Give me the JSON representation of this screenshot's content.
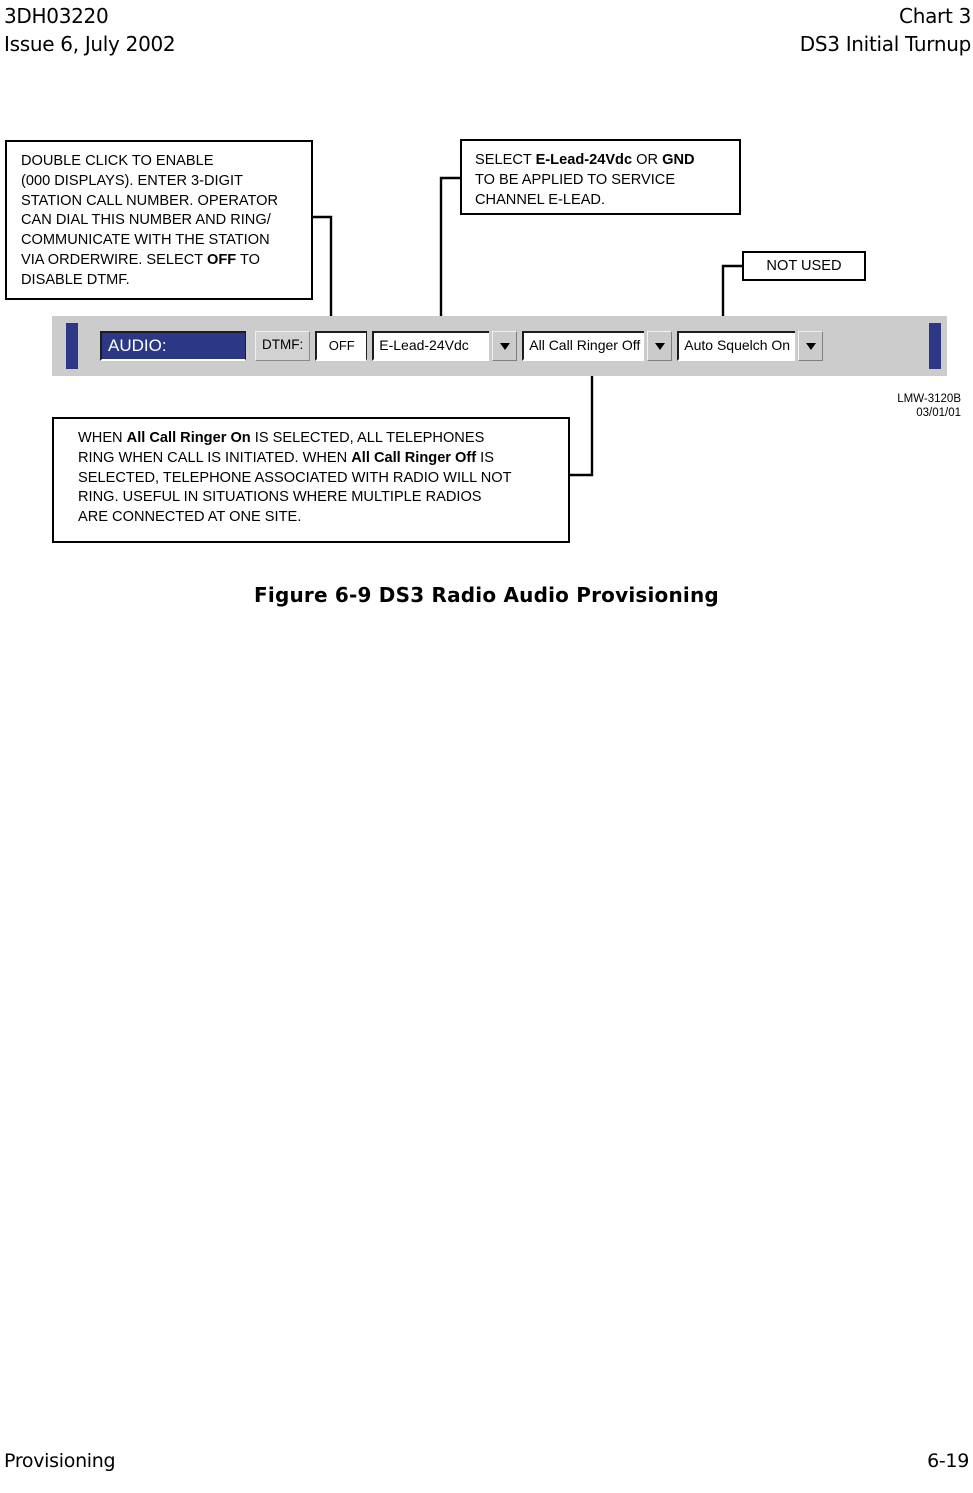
{
  "header": {
    "doc_number": "3DH03220",
    "issue": "Issue 6, July 2002",
    "chart": "Chart 3",
    "subtitle": "DS3 Initial Turnup"
  },
  "callouts": {
    "dtmf": {
      "name": "dtmf-callout",
      "line1": "DOUBLE CLICK TO ENABLE",
      "line2": "(000 DISPLAYS). ENTER 3-DIGIT",
      "line3": "STATION CALL NUMBER. OPERATOR",
      "line4": "CAN DIAL THIS NUMBER AND RING/",
      "line5": "COMMUNICATE WITH THE STATION",
      "line6_pre": "VIA ORDERWIRE. SELECT ",
      "line6_bold": "OFF",
      "line6_post": " TO",
      "line7": "DISABLE DTMF."
    },
    "elead": {
      "name": "e-lead-callout",
      "line1_pre": "SELECT ",
      "line1_bold1": "E-Lead-24Vdc",
      "line1_mid": " OR ",
      "line1_bold2": "GND",
      "line2": "TO BE APPLIED TO SERVICE",
      "line3": "CHANNEL E-LEAD."
    },
    "not_used": {
      "name": "not-used-callout",
      "text": "NOT USED"
    },
    "ringer": {
      "name": "all-call-ringer-callout",
      "line1_pre": "WHEN ",
      "line1_bold": "All Call Ringer On",
      "line1_post": " IS SELECTED, ALL TELEPHONES",
      "line2_pre": "RING WHEN CALL IS INITIATED. WHEN ",
      "line2_bold": "All Call Ringer Off",
      "line2_post": " IS",
      "line3": "SELECTED, TELEPHONE ASSOCIATED WITH RADIO WILL NOT",
      "line4": "RING. USEFUL IN SITUATIONS WHERE MULTIPLE RADIOS",
      "line5": "ARE CONNECTED AT ONE SITE."
    }
  },
  "audio_panel": {
    "title": "AUDIO:",
    "dtmf_label": "DTMF:",
    "dtmf_value": "OFF",
    "elead_value": "E-Lead-24Vdc",
    "ringer_value": "All Call Ringer Off",
    "squelch_value": "Auto Squelch On",
    "accent_color": "#2c3885",
    "panel_color": "#cccccc",
    "dropdown_icon": "chevron-down-icon"
  },
  "drawing_credit": {
    "number": "LMW-3120B",
    "date": "03/01/01"
  },
  "figure": {
    "caption": "Figure 6-9  DS3 Radio Audio Provisioning"
  },
  "footer": {
    "section": "Provisioning",
    "page": "6-19"
  }
}
